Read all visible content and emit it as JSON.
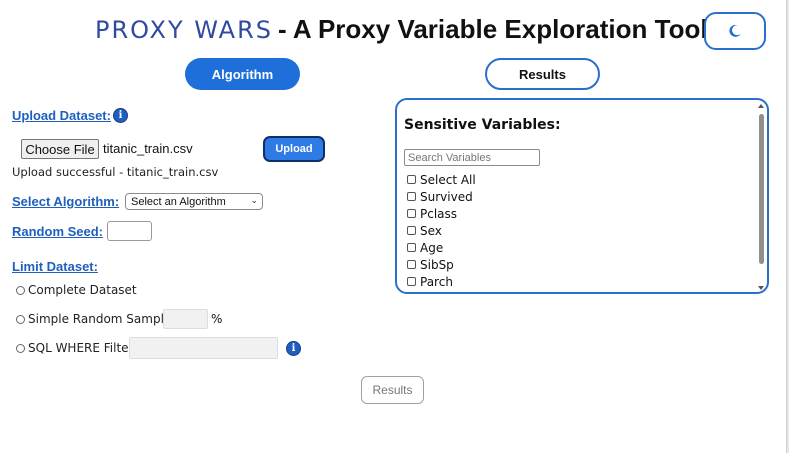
{
  "header": {
    "logo_text": "PROXY WARS",
    "title": "- A Proxy Variable Exploration Tool",
    "theme_toggle_icon": "moon-icon"
  },
  "tabs": {
    "algorithm_label": "Algorithm",
    "results_label": "Results"
  },
  "upload": {
    "label": "Upload Dataset:",
    "choose_file_label": "Choose File",
    "file_name": "titanic_train.csv",
    "upload_button_label": "Upload",
    "status_text": "Upload successful - titanic_train.csv"
  },
  "algorithm": {
    "label": "Select Algorithm:",
    "selected_value": "Select an Algorithm"
  },
  "random_seed": {
    "label": "Random Seed:",
    "value": ""
  },
  "limit_dataset": {
    "label": "Limit Dataset:",
    "options": [
      {
        "label": "Complete Dataset"
      },
      {
        "label": "Simple Random Sample:",
        "value": "",
        "unit": "%"
      },
      {
        "label": "SQL WHERE Filter:",
        "value": ""
      }
    ]
  },
  "results_button_label": "Results",
  "sensitive_variables": {
    "title": "Sensitive Variables:",
    "search_placeholder": "Search Variables",
    "items": [
      "Select All",
      "Survived",
      "Pclass",
      "Sex",
      "Age",
      "SibSp",
      "Parch"
    ]
  },
  "colors": {
    "accent": "#1e6fd9",
    "logo": "#2f4aa0",
    "link": "#1e5fbf"
  }
}
